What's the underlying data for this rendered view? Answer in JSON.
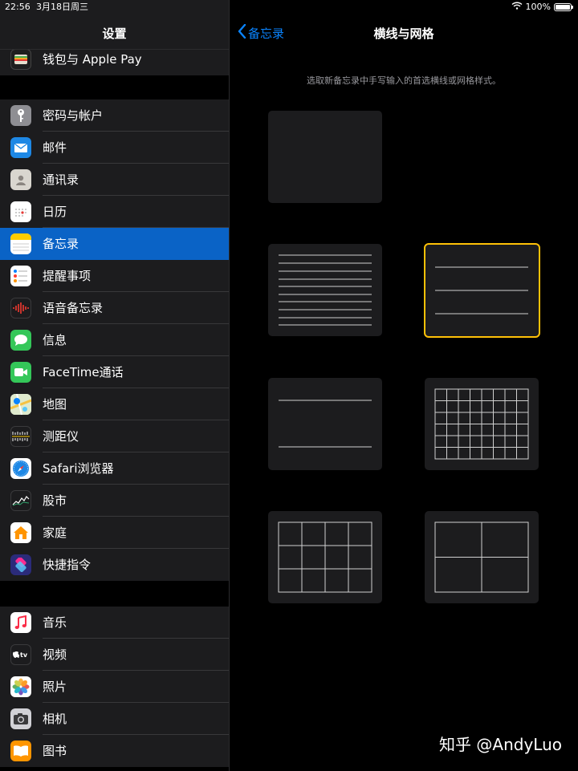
{
  "status": {
    "time": "22:56",
    "date": "3月18日周三",
    "battery": "100%"
  },
  "sidebar": {
    "title": "设置",
    "groups": [
      {
        "items": [
          {
            "label": "钱包与 Apple Pay",
            "icon": "wallet-icon"
          }
        ]
      },
      {
        "items": [
          {
            "label": "密码与帐户",
            "icon": "key-icon"
          },
          {
            "label": "邮件",
            "icon": "mail-icon"
          },
          {
            "label": "通讯录",
            "icon": "contacts-icon"
          },
          {
            "label": "日历",
            "icon": "calendar-icon"
          },
          {
            "label": "备忘录",
            "icon": "notes-icon"
          },
          {
            "label": "提醒事项",
            "icon": "reminders-icon"
          },
          {
            "label": "语音备忘录",
            "icon": "voice-memos-icon"
          },
          {
            "label": "信息",
            "icon": "messages-icon"
          },
          {
            "label": "FaceTime通话",
            "icon": "facetime-icon"
          },
          {
            "label": "地图",
            "icon": "maps-icon"
          },
          {
            "label": "测距仪",
            "icon": "measure-icon"
          },
          {
            "label": "Safari浏览器",
            "icon": "safari-icon"
          },
          {
            "label": "股市",
            "icon": "stocks-icon"
          },
          {
            "label": "家庭",
            "icon": "home-icon"
          },
          {
            "label": "快捷指令",
            "icon": "shortcuts-icon"
          }
        ]
      },
      {
        "items": [
          {
            "label": "音乐",
            "icon": "music-icon"
          },
          {
            "label": "视频",
            "icon": "tv-icon"
          },
          {
            "label": "照片",
            "icon": "photos-icon"
          },
          {
            "label": "相机",
            "icon": "camera-icon"
          },
          {
            "label": "图书",
            "icon": "books-icon"
          }
        ]
      }
    ]
  },
  "detail": {
    "back_label": "备忘录",
    "title": "横线与网格",
    "hint": "选取新备忘录中手写输入的首选横线或网格样式。",
    "options": [
      {
        "name": "blank-option",
        "selected": false
      },
      {
        "name": "small-lines-option",
        "selected": false
      },
      {
        "name": "medium-lines-option",
        "selected": true
      },
      {
        "name": "large-lines-option",
        "selected": false
      },
      {
        "name": "small-grid-option",
        "selected": false
      },
      {
        "name": "medium-grid-option",
        "selected": false
      },
      {
        "name": "large-grid-option",
        "selected": false
      }
    ]
  },
  "colors": {
    "accent": "#0a84ff",
    "selection": "#0a63c6",
    "selected_border": "#ffc107"
  },
  "watermark": "知乎 @AndyLuo"
}
